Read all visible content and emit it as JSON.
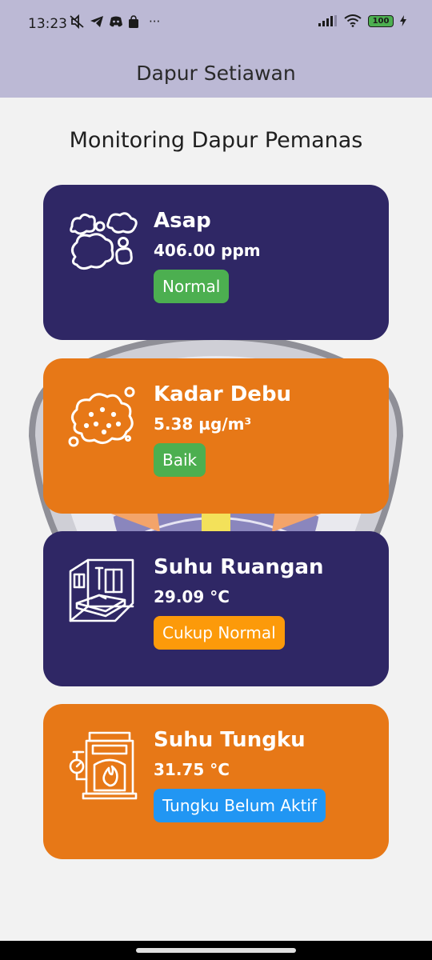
{
  "status_bar": {
    "time": "13:23",
    "icons_left": [
      "mute-icon",
      "telegram-icon",
      "discord-icon",
      "shopping-bag-icon",
      "more-icon"
    ],
    "icons_right": [
      "signal-icon",
      "wifi-icon",
      "battery-icon",
      "charging-icon"
    ],
    "more": "···",
    "battery_level": "100"
  },
  "app_bar": {
    "title": "Dapur Setiawan",
    "background": "#bcb9d5"
  },
  "page": {
    "title": "Monitoring Dapur Pemanas"
  },
  "cards": [
    {
      "title": "Asap",
      "value": "406.00 ppm",
      "status": "Normal",
      "color": "#2f2765",
      "badge_color": "#4caf50",
      "icon": "smoke-icon"
    },
    {
      "title": "Kadar Debu",
      "value": "5.38 µg/m³",
      "status": "Baik",
      "color": "#e77817",
      "badge_color": "#4caf50",
      "icon": "dust-icon"
    },
    {
      "title": "Suhu Ruangan",
      "value": "29.09 °C",
      "status": "Cukup Normal",
      "color": "#2f2765",
      "badge_color": "#fc9a0a",
      "icon": "room-icon"
    },
    {
      "title": "Suhu Tungku",
      "value": "31.75 °C",
      "status": "Tungku Belum Aktif",
      "color": "#e77817",
      "badge_color": "#2196f3",
      "icon": "furnace-icon"
    }
  ]
}
